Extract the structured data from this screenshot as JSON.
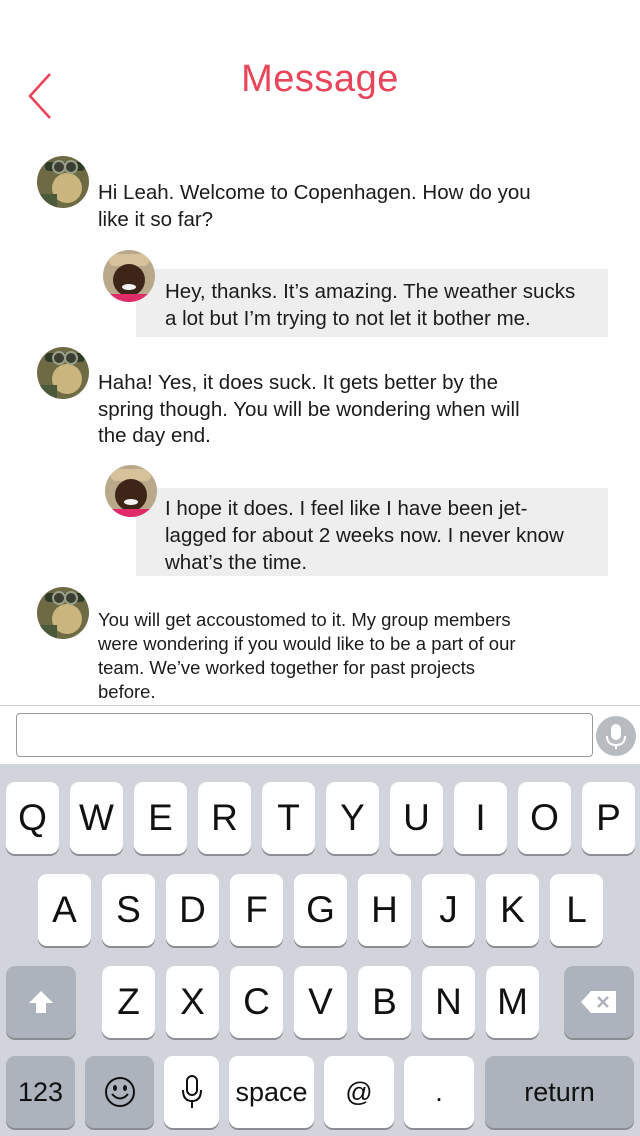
{
  "header": {
    "title": "Message"
  },
  "messages": [
    {
      "side": "left",
      "avatar": "man-goggles-avatar",
      "lines": [
        "Hi Leah. Welcome to Copenhagen. How do you",
        "like it so far?"
      ]
    },
    {
      "side": "right",
      "avatar": "woman-hat-avatar",
      "lines": [
        "Hey, thanks. It’s amazing. The weather sucks",
        "a lot but I’m trying to not let it bother me."
      ]
    },
    {
      "side": "left",
      "avatar": "man-goggles-avatar",
      "lines": [
        "Haha! Yes, it does suck. It gets better by the",
        "spring though. You will be wondering when will",
        "the day end."
      ]
    },
    {
      "side": "right",
      "avatar": "woman-hat-avatar",
      "lines": [
        "I hope it does. I feel like I have been jet-",
        "lagged for about 2 weeks now. I never know",
        "what’s the time."
      ]
    },
    {
      "side": "left",
      "avatar": "man-goggles-avatar",
      "lines": [
        "You will get accoustomed to it. My group members",
        "were wondering if you would like to be a part of our",
        "team. We’ve worked together for past projects",
        "before."
      ]
    }
  ],
  "composer": {
    "value": "",
    "mic_icon": "microphone-icon"
  },
  "keyboard": {
    "row1": [
      "Q",
      "W",
      "E",
      "R",
      "T",
      "Y",
      "U",
      "I",
      "O",
      "P"
    ],
    "row2": [
      "A",
      "S",
      "D",
      "F",
      "G",
      "H",
      "J",
      "K",
      "L"
    ],
    "row3": [
      "Z",
      "X",
      "C",
      "V",
      "B",
      "N",
      "M"
    ],
    "shift_icon": "shift-arrow-icon",
    "delete_icon": "backspace-icon",
    "numbers_label": "123",
    "emoji_icon": "emoji-icon",
    "dictation_icon": "microphone-icon",
    "space_label": "space",
    "at_label": "@",
    "period_label": ".",
    "return_label": "return"
  },
  "colors": {
    "accent": "#e8455a",
    "bubble": "#eeeeee",
    "keyboard_bg": "#d1d5db",
    "dark_key": "#adb3bc"
  }
}
